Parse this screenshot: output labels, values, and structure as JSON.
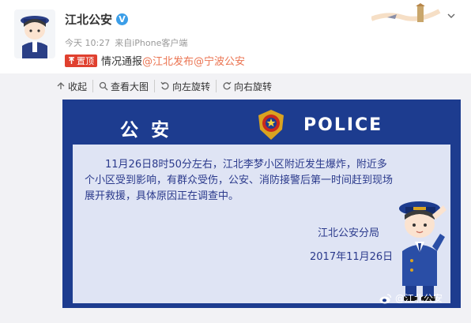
{
  "header": {
    "author": "江北公安",
    "verified_mark": "V",
    "time": "今天 10:27",
    "source_prefix": "来自",
    "source": "iPhone客户端",
    "pin_label": "置顶",
    "post_text": "情况通报",
    "mentions": [
      "@江北发布",
      "@宁波公安"
    ]
  },
  "toolbar": {
    "items": [
      {
        "label": "收起",
        "icon": "arrow-up-icon"
      },
      {
        "label": "查看大图",
        "icon": "zoom-icon"
      },
      {
        "label": "向左旋转",
        "icon": "rotate-left-icon"
      },
      {
        "label": "向右旋转",
        "icon": "rotate-right-icon"
      }
    ]
  },
  "notice": {
    "banner_left": "公安",
    "banner_right": "POLICE",
    "body": "11月26日8时50分左右，江北李梦小区附近发生爆炸，附近多个小区受到影响，有群众受伤，公安、消防接警后第一时间赶到现场展开救援，具体原因正在调查中。",
    "signature_org": "江北公安分局",
    "signature_date": "2017年11月26日"
  },
  "watermark": "@江北公安",
  "colors": {
    "navy": "#1d3c8f",
    "panel": "#dfe4f4",
    "text_blue": "#2b3a8c",
    "mention": "#eb7350",
    "pin": "#e0402f"
  }
}
